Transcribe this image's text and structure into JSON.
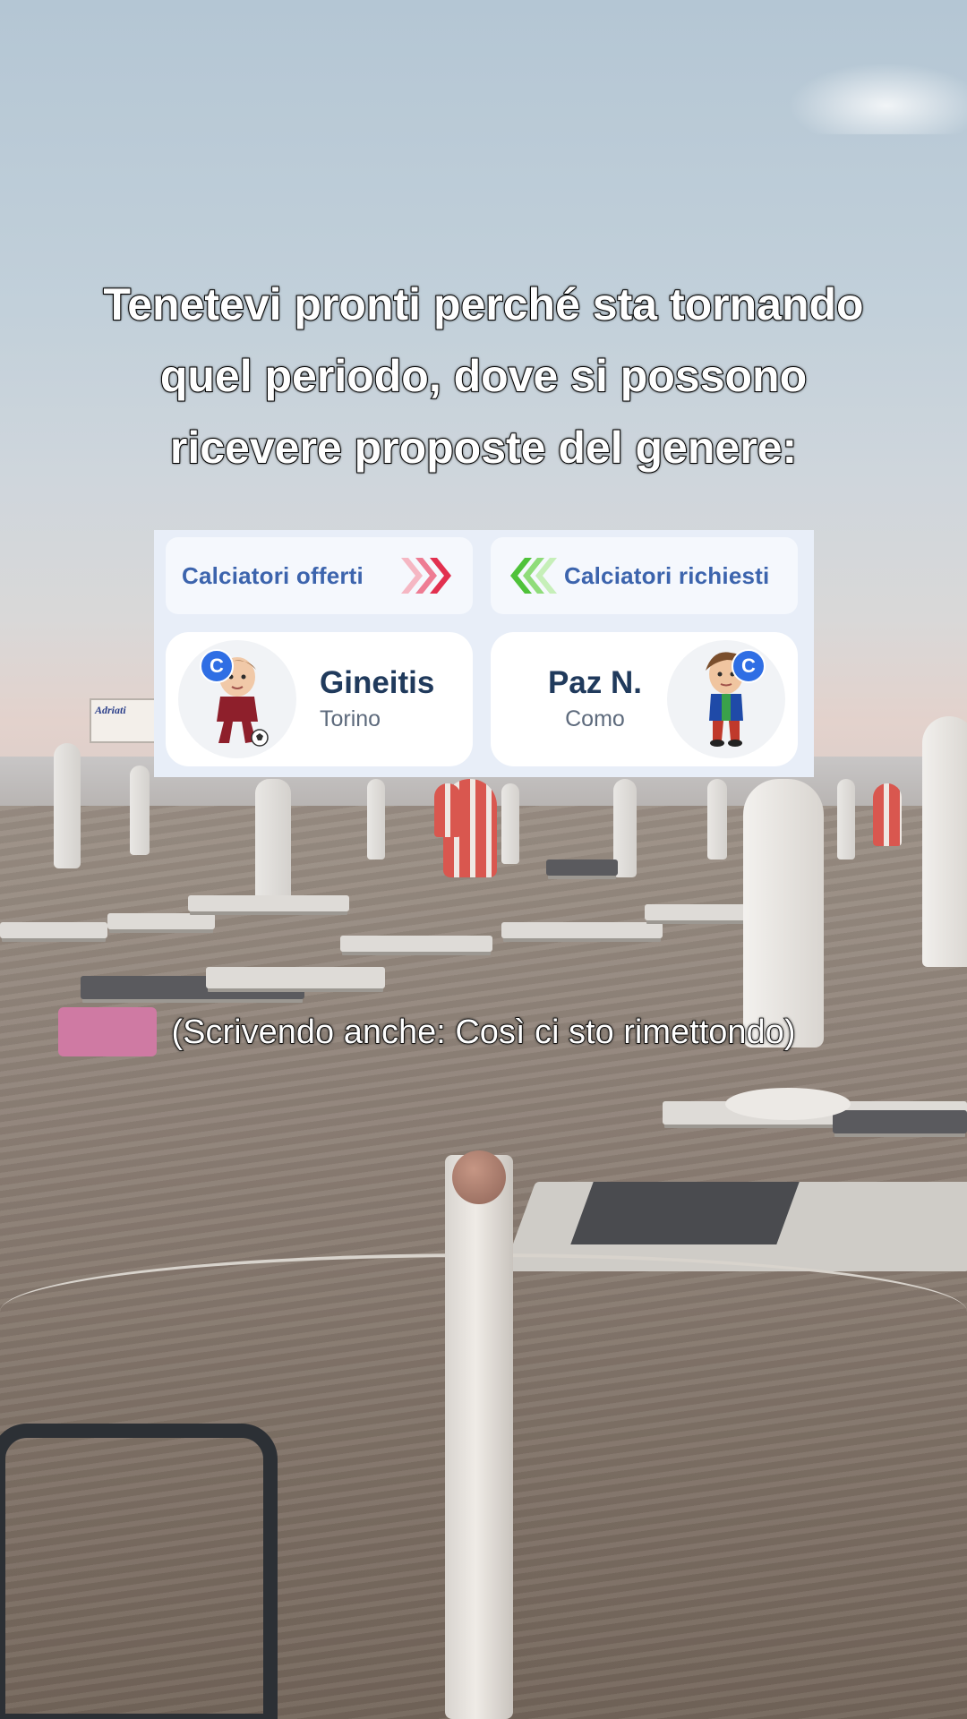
{
  "caption": {
    "line1": "Tenetevi pronti perché sta tornando",
    "line2": "quel periodo, dove si possono",
    "line3": "ricevere proposte del genere:",
    "subtitle": "(Scrivendo anche: Così ci sto rimettondo)"
  },
  "trade": {
    "offered_label": "Calciatori offerti",
    "requested_label": "Calciatori richiesti",
    "offered_arrow_color": "#e2304f",
    "requested_arrow_color": "#4fc23a",
    "offered_player": {
      "name": "Gineitis",
      "team": "Torino",
      "role": "C",
      "avatar_icon": "player-avatar-icon"
    },
    "requested_player": {
      "name": "Paz N.",
      "team": "Como",
      "role": "C",
      "avatar_icon": "player-avatar-icon"
    }
  },
  "scene": {
    "sign_text": "Adriati"
  }
}
